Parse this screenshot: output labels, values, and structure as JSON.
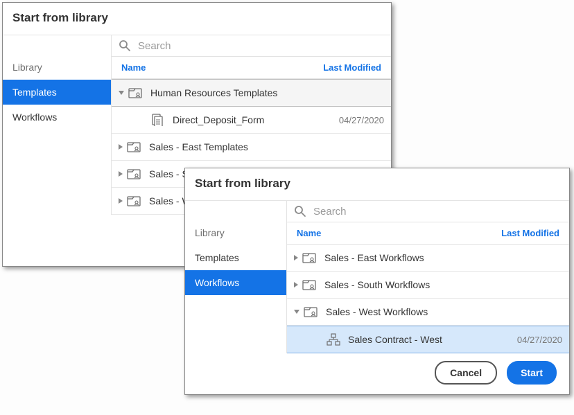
{
  "dialogA": {
    "title": "Start from library",
    "search_placeholder": "Search",
    "sidebar": {
      "heading": "Library",
      "items": [
        "Templates",
        "Workflows"
      ],
      "active": 0
    },
    "columns": {
      "name": "Name",
      "modified": "Last Modified"
    },
    "rows": [
      {
        "type": "folder",
        "label": "Human Resources Templates",
        "expanded": true
      },
      {
        "type": "file",
        "label": "Direct_Deposit_Form",
        "date": "04/27/2020",
        "child": true
      },
      {
        "type": "folder",
        "label": "Sales - East Templates",
        "expanded": false
      },
      {
        "type": "folder",
        "label": "Sales - South Templates",
        "expanded": false,
        "truncated": "Sales - So"
      },
      {
        "type": "folder",
        "label": "Sales - West Templates",
        "expanded": false,
        "truncated": "Sales - W"
      }
    ]
  },
  "dialogB": {
    "title": "Start from library",
    "search_placeholder": "Search",
    "sidebar": {
      "heading": "Library",
      "items": [
        "Templates",
        "Workflows"
      ],
      "active": 1
    },
    "columns": {
      "name": "Name",
      "modified": "Last Modified"
    },
    "rows": [
      {
        "type": "folder",
        "label": "Sales - East Workflows",
        "expanded": false
      },
      {
        "type": "folder",
        "label": "Sales - South Workflows",
        "expanded": false
      },
      {
        "type": "folder",
        "label": "Sales - West Workflows",
        "expanded": true
      },
      {
        "type": "workflow",
        "label": "Sales Contract - West",
        "date": "04/27/2020",
        "child": true,
        "selected": true
      }
    ],
    "buttons": {
      "cancel": "Cancel",
      "start": "Start"
    }
  }
}
